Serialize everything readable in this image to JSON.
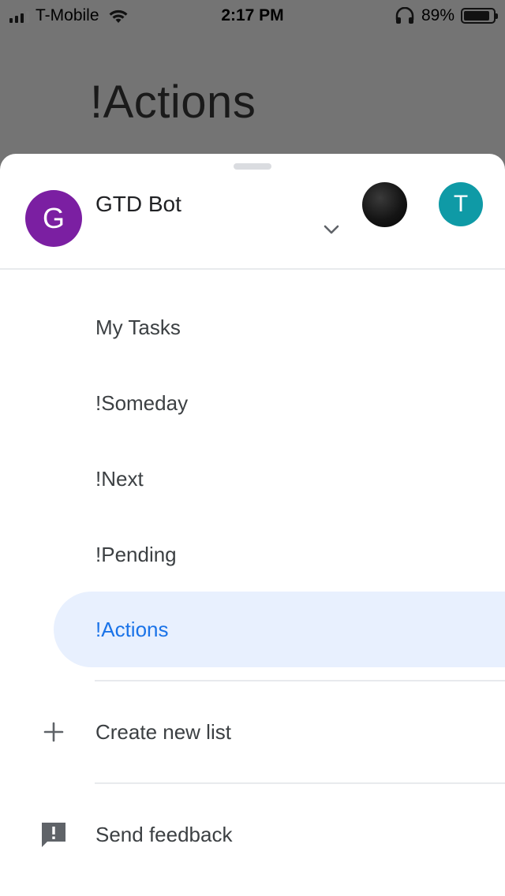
{
  "status_bar": {
    "carrier": "T-Mobile",
    "time": "2:17 PM",
    "battery_percent": "89%",
    "battery_level": 0.89,
    "icons": [
      "cell-signal-icon",
      "wifi-icon",
      "headphones-icon",
      "battery-icon"
    ]
  },
  "background": {
    "title": "!Actions"
  },
  "account": {
    "initial": "G",
    "name": "GTD Bot",
    "avatar_color": "#7b1fa2",
    "other_accounts": [
      {
        "initial": "",
        "color": "#111111"
      },
      {
        "initial": "T",
        "color": "#0f9aa6"
      }
    ]
  },
  "lists": [
    {
      "label": "My Tasks",
      "active": false
    },
    {
      "label": "!Someday",
      "active": false
    },
    {
      "label": "!Next",
      "active": false
    },
    {
      "label": "!Pending",
      "active": false
    },
    {
      "label": "!Actions",
      "active": true
    }
  ],
  "actions": {
    "create_list": "Create new list",
    "send_feedback": "Send feedback"
  },
  "colors": {
    "accent": "#1a73e8",
    "active_bg": "#e8f0fe",
    "scrim": "#747474"
  }
}
